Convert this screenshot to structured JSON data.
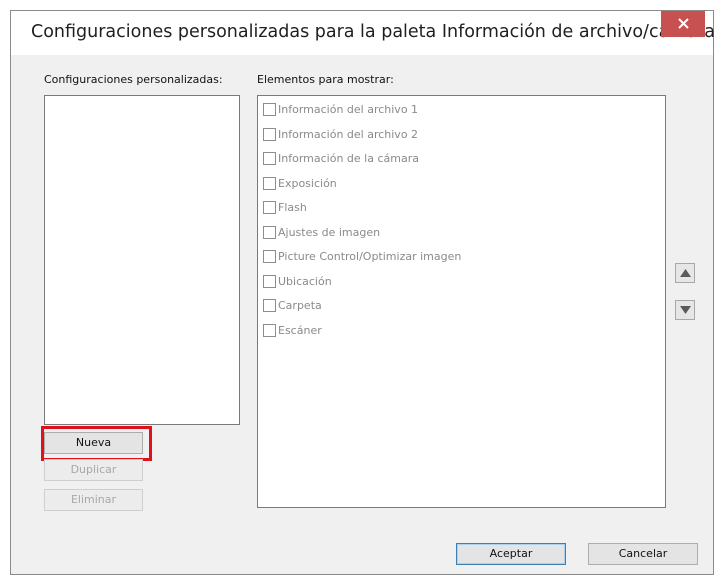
{
  "dialog": {
    "title": "Configuraciones personalizadas para la paleta Información de archivo/cámara"
  },
  "left_panel": {
    "label": "Configuraciones personalizadas:"
  },
  "right_panel": {
    "label": "Elementos para mostrar:",
    "items": [
      {
        "label": "Información del archivo 1",
        "checked": false
      },
      {
        "label": "Información del archivo 2",
        "checked": false
      },
      {
        "label": "Información de la cámara",
        "checked": false
      },
      {
        "label": "Exposición",
        "checked": false
      },
      {
        "label": "Flash",
        "checked": false
      },
      {
        "label": "Ajustes de imagen",
        "checked": false
      },
      {
        "label": "Picture Control/Optimizar imagen",
        "checked": false
      },
      {
        "label": "Ubicación",
        "checked": false
      },
      {
        "label": "Carpeta",
        "checked": false
      },
      {
        "label": "Escáner",
        "checked": false
      }
    ]
  },
  "buttons": {
    "new": "Nueva",
    "duplicate": "Duplicar",
    "delete": "Eliminar",
    "ok": "Aceptar",
    "cancel": "Cancelar"
  },
  "icons": {
    "close": "close-icon",
    "up": "arrow-up-icon",
    "down": "arrow-down-icon"
  },
  "colors": {
    "close_button": "#c75050",
    "highlight": "#e0101c"
  }
}
